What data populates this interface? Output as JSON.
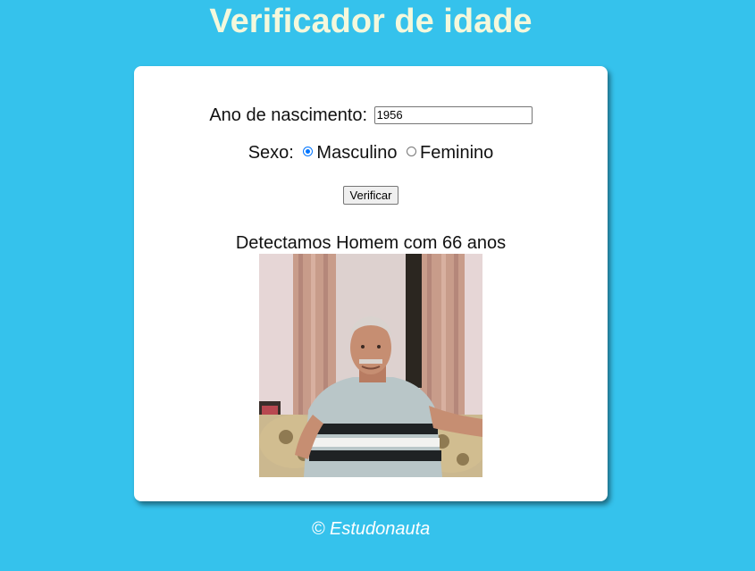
{
  "page": {
    "title": "Verificador de idade",
    "footer": "© Estudonauta"
  },
  "form": {
    "birth_year_label": "Ano de nascimento:",
    "birth_year_value": "1956",
    "sex_label": "Sexo:",
    "sex_options": [
      {
        "label": "Masculino",
        "checked": true
      },
      {
        "label": "Feminino",
        "checked": false
      }
    ],
    "submit_label": "Verificar"
  },
  "result": {
    "text": "Detectamos Homem com 66 anos",
    "image": "photo of elderly man seated in armchair"
  },
  "colors": {
    "background": "#35c2ec",
    "title": "#f4f8dc",
    "card": "#ffffff",
    "radio_accent": "#0075ff"
  }
}
